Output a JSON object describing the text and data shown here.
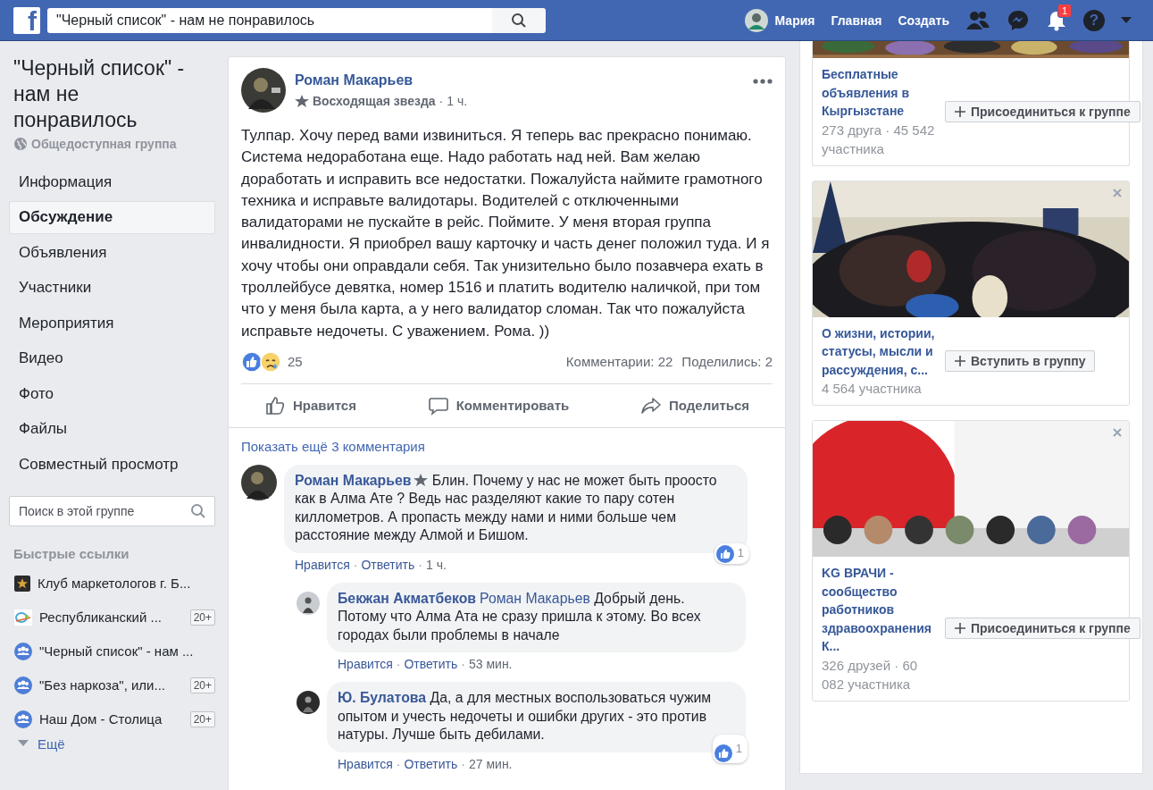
{
  "topbar": {
    "logo": "f",
    "search": {
      "value": "\"Черный список\" - нам не понравилось"
    },
    "user": "Мария",
    "nav": [
      "Главная",
      "Создать"
    ],
    "notifications_badge": "1",
    "help": "?"
  },
  "sidebar": {
    "group_title": "\"Черный список\" - нам не понравилось",
    "privacy": "Общедоступная группа",
    "nav": [
      {
        "label": "Информация",
        "selected": false
      },
      {
        "label": "Обсуждение",
        "selected": true
      },
      {
        "label": "Объявления",
        "selected": false
      },
      {
        "label": "Участники",
        "selected": false
      },
      {
        "label": "Мероприятия",
        "selected": false
      },
      {
        "label": "Видео",
        "selected": false
      },
      {
        "label": "Фото",
        "selected": false
      },
      {
        "label": "Файлы",
        "selected": false
      },
      {
        "label": "Совместный просмотр",
        "selected": false
      }
    ],
    "search": {
      "placeholder": "Поиск в этой группе"
    },
    "quick_links_title": "Быстрые ссылки",
    "quick_links": [
      {
        "kind": "page",
        "label": "Клуб маркетологов г. Б..."
      },
      {
        "kind": "site",
        "label": "Республиканский ...",
        "count": "20+"
      },
      {
        "kind": "group",
        "label": "\"Черный список\" - нам ..."
      },
      {
        "kind": "group",
        "label": "\"Без наркоза\", или...",
        "count": "20+"
      },
      {
        "kind": "group",
        "label": "Наш Дом - Столица",
        "count": "20+"
      }
    ],
    "more": "Ещё"
  },
  "post": {
    "author": "Роман Макарьев",
    "badge": "Восходящая звезда",
    "separator": "·",
    "time": "1 ч.",
    "text": "Тулпар. Хочу перед вами извиниться. Я теперь вас прекрасно понимаю. Система недоработана еще. Надо работать над ней. Вам желаю доработать и исправить все недостатки. Пожалуйста наймите грамотного техника и исправьте валидотары. Водителей с отключенными валидаторами не пускайте в рейс. Поймите. У меня вторая группа инвалидности. Я приобрел вашу карточку и часть денег положил туда. И я хочу чтобы они оправдали себя. Так унизительно было позавчера ехать в троллейбусе девятка, номер 1516 и платить водителю наличкой, при том что у меня была карта, а у него валидатор сломан. Так что пожалуйста исправьте недочеты. С уважением. Рома. ))",
    "reactions_count": "25",
    "comments_count": "Комментарии: 22",
    "shares_count": "Поделились: 2",
    "actions": [
      "Нравится",
      "Комментировать",
      "Поделиться"
    ],
    "show_more": "Показать ещё 3 комментария",
    "comments": [
      {
        "author": "Роман Макарьев",
        "star": true,
        "text": "Блин. Почему у нас не может быть проосто как в Алма Ате ? Ведь нас разделяют какие то пару сотен киллометров. А пропасть между нами и ними больше чем расстояние между Алмой и Бишом.",
        "actions": [
          "Нравится",
          "Ответить"
        ],
        "separators": [
          "·",
          "·"
        ],
        "time": "1 ч.",
        "likes": "1",
        "children": [
          {
            "author": "Бекжан Акматбеков",
            "mention": "Роман Макарьев",
            "text": "Добрый день. Потому что Алма Ата не сразу пришла к этому. Во всех городах были проблемы в начале",
            "actions": [
              "Нравится",
              "Ответить"
            ],
            "separators": [
              "·",
              "·"
            ],
            "time": "53 мин."
          },
          {
            "author": "Ю. Булатова",
            "text": "Да, а для местных воспользоваться чужим опытом и учесть недочеты и ошибки других - это против натуры. Лучше быть дебилами.",
            "actions": [
              "Нравится",
              "Ответить"
            ],
            "separators": [
              "·",
              "·"
            ],
            "time": "27 мин.",
            "likes": "1"
          }
        ]
      }
    ]
  },
  "suggestions": [
    {
      "title": "Бесплатные объявления в Кыргызстане",
      "meta": "273 друга · 45 542 участника",
      "button": "Присоединиться к группе"
    },
    {
      "title": "О жизни, истории, статусы, мысли и рассуждения, с...",
      "meta": "4 564 участника",
      "button": "Вступить в группу",
      "dismissible": true
    },
    {
      "title": "KG ВРАЧИ - сообщество работников здравоохранения К...",
      "meta": "326 друзей · 60 082 участника",
      "button": "Присоединиться к группе",
      "dismissible": true
    }
  ]
}
